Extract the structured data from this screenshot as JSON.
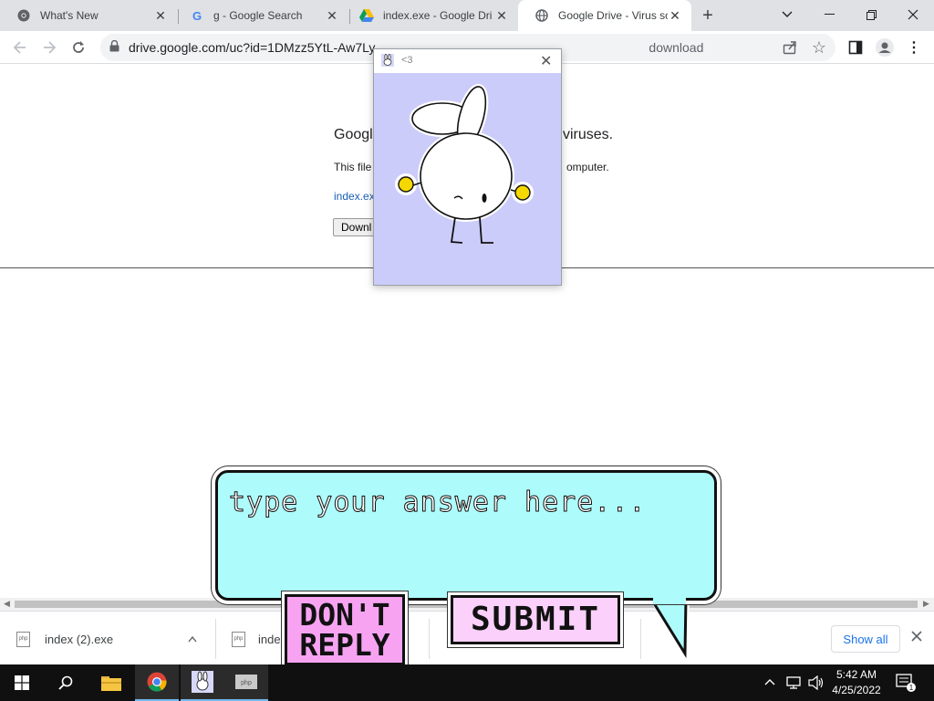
{
  "browser": {
    "tabs": [
      {
        "title": "What's New",
        "icon": "chrome-icon",
        "active": false
      },
      {
        "title": "g - Google Search",
        "icon": "google-g-icon",
        "active": false
      },
      {
        "title": "index.exe - Google Dri",
        "icon": "google-drive-icon",
        "active": false
      },
      {
        "title": "Google Drive - Virus sc",
        "icon": "globe-icon",
        "active": true
      }
    ],
    "url_start": "drive.google.com/uc?id=1DMzz5YtL-Aw7Ly",
    "url_end": "download"
  },
  "page": {
    "heading_left": "Google",
    "heading_right": "viruses.",
    "line2_left": "This file",
    "line2_right": "omputer.",
    "file_link": "index.ex",
    "download_label": "Downl"
  },
  "popup": {
    "title": "<3"
  },
  "game": {
    "answer_placeholder": "type your answer here...",
    "dont_reply_label": "DON'T REPLY",
    "submit_label": "SUBMIT"
  },
  "downloads": {
    "items": [
      {
        "name": "index (2).exe"
      },
      {
        "name": "index"
      }
    ],
    "show_all_label": "Show all"
  },
  "taskbar": {
    "time": "5:42 AM",
    "date": "4/25/2022"
  },
  "colors": {
    "bubble": "#aefbfb",
    "dont_reply": "#f7a3f2",
    "submit": "#fbd0fb",
    "popup_bg": "#ccccfb",
    "link": "#1a5fb4"
  }
}
